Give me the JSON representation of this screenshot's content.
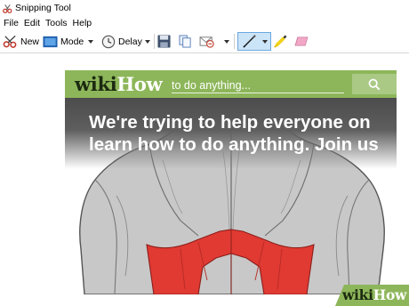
{
  "window": {
    "title": "Snipping Tool"
  },
  "menu": {
    "items": [
      "File",
      "Edit",
      "Tools",
      "Help"
    ]
  },
  "toolbar": {
    "new_label": "New",
    "mode_label": "Mode",
    "delay_label": "Delay"
  },
  "wikihow": {
    "logo_wiki": "wiki",
    "logo_how": "How",
    "search_placeholder": "to do anything...",
    "hero_line1": "We're trying to help everyone on",
    "hero_line2": "learn how to do anything. Join us"
  },
  "watermark": {
    "wiki": "wiki",
    "how": "How"
  },
  "colors": {
    "wikihow_green": "#8db65a",
    "muscle_red": "#e03a33",
    "skin_gray": "#c9c9c9",
    "active_tool_bg": "#cce4f7"
  },
  "icons": [
    "snipping-tool-icon",
    "scissors-icon",
    "mode-icon",
    "clock-icon",
    "save-icon",
    "copy-icon",
    "send-email-icon",
    "pen-icon",
    "highlighter-icon",
    "eraser-icon",
    "search-icon"
  ]
}
